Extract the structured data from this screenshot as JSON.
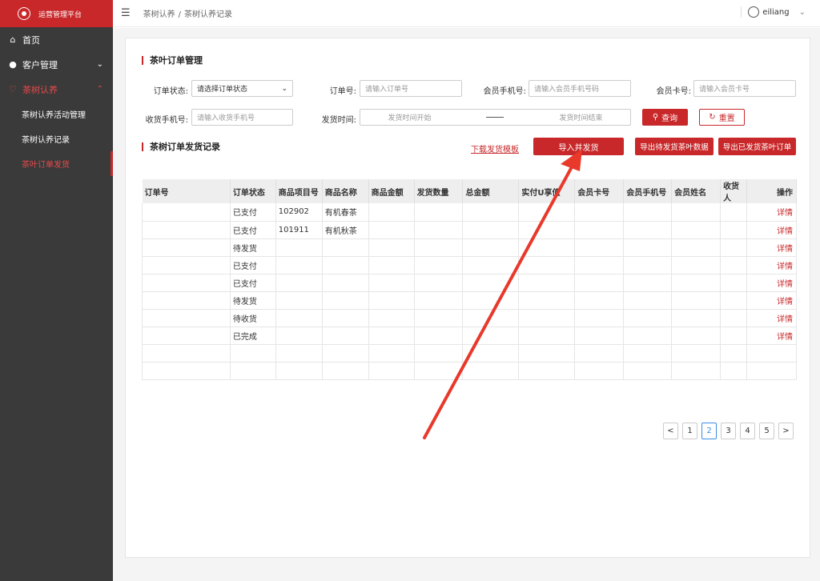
{
  "sidebar": {
    "brand_title": "运营管理平台",
    "items": [
      {
        "icon": "home-icon",
        "label": "首页"
      },
      {
        "icon": "user-icon",
        "label": "客户管理"
      },
      {
        "icon": "heart-icon",
        "label": "茶树认养"
      }
    ],
    "sub_items": [
      {
        "label": "茶树认养活动管理"
      },
      {
        "label": "茶树认养记录"
      },
      {
        "label": "茶叶订单发货"
      }
    ]
  },
  "header": {
    "breadcrumb": [
      "茶树认养",
      "茶树认养记录"
    ],
    "breadcrumb_sep": "/",
    "username": "eiliang"
  },
  "filter": {
    "section_title": "茶叶订单管理",
    "order_status_label": "订单状态:",
    "order_status_value": "请选择订单状态",
    "order_no_label": "订单号:",
    "order_no_placeholder": "请输入订单号",
    "member_phone_label": "会员手机号:",
    "member_phone_placeholder": "请输入会员手机号码",
    "member_card_label": "会员卡号:",
    "member_card_placeholder": "请输入会员卡号",
    "receiver_phone_label": "收货手机号:",
    "receiver_phone_placeholder": "请输入收货手机号",
    "ship_time_label": "发货时间:",
    "ship_start_placeholder": "发货时间开始",
    "ship_end_placeholder": "发货时间结束",
    "query_label": "查询",
    "reset_label": "重置"
  },
  "records": {
    "section_title": "茶树订单发货记录",
    "download_template": "下载发货模板",
    "import_ship": "导入并发货",
    "export_pending": "导出待发货茶叶数据",
    "export_shipped": "导出已发货茶叶订单"
  },
  "table": {
    "columns": [
      "订单号",
      "订单状态",
      "商品项目号",
      "商品名称",
      "商品金额",
      "发货数量",
      "总金额",
      "实付U享值",
      "会员卡号",
      "会员手机号",
      "会员姓名",
      "收货人",
      "操作"
    ],
    "rows": [
      {
        "status": "已支付",
        "item_no": "102902",
        "item_name": "有机春茶",
        "op": "详情"
      },
      {
        "status": "已支付",
        "item_no": "101911",
        "item_name": "有机秋茶",
        "op": "详情"
      },
      {
        "status": "待发货",
        "item_no": "",
        "item_name": "",
        "op": "详情"
      },
      {
        "status": "已支付",
        "item_no": "",
        "item_name": "",
        "op": "详情"
      },
      {
        "status": "已支付",
        "item_no": "",
        "item_name": "",
        "op": "详情"
      },
      {
        "status": "待发货",
        "item_no": "",
        "item_name": "",
        "op": "详情"
      },
      {
        "status": "待收货",
        "item_no": "",
        "item_name": "",
        "op": "详情"
      },
      {
        "status": "已完成",
        "item_no": "",
        "item_name": "",
        "op": "详情"
      },
      {
        "status": "",
        "item_no": "",
        "item_name": "",
        "op": ""
      },
      {
        "status": "",
        "item_no": "",
        "item_name": "",
        "op": ""
      }
    ]
  },
  "pagination": {
    "prev": "<",
    "next": ">",
    "pages": [
      "1",
      "2",
      "3",
      "4",
      "5"
    ],
    "current": "2"
  },
  "colors": {
    "accent": "#c8282a",
    "sidebar_bg": "#3a3a3a",
    "annotation_arrow": "#e8392b"
  }
}
